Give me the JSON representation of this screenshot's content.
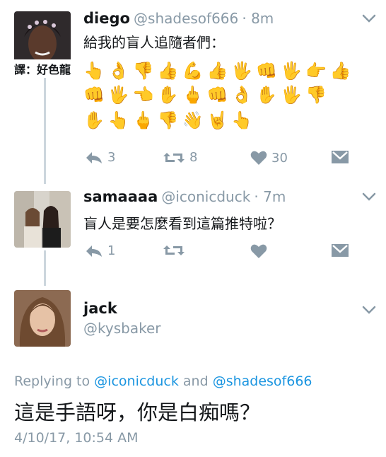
{
  "tweets": [
    {
      "name": "diego",
      "handle": "@shadesof666",
      "time": "· 8m",
      "text": "給我的盲人追隨者們：",
      "translation_label": "譯：好色龍",
      "emoji_rows": [
        [
          "👆",
          "👌",
          "👎",
          "👍",
          "💪",
          "👍",
          "🖐",
          "👊",
          "🖐",
          "👉",
          "👍"
        ],
        [
          "👊",
          "🖐",
          "👈",
          "✋",
          "🖕",
          "👊",
          "👌",
          "✋",
          "🖐",
          "👎"
        ],
        [
          "✋",
          "👆",
          "🖕",
          "👎",
          "👋",
          "🤘",
          "👆"
        ]
      ],
      "reply_count": "3",
      "retweet_count": "8",
      "like_count": "30"
    },
    {
      "name": "samaaaa",
      "handle": "@iconicduck",
      "time": "· 7m",
      "text": "盲人是要怎麼看到這篇推特啦？",
      "reply_count": "1"
    },
    {
      "name": "jack",
      "handle": "@kysbaker"
    }
  ],
  "main_tweet": {
    "replying_prefix": "Replying to",
    "mention_1": "@iconicduck",
    "replying_and": "and",
    "mention_2": "@shadesof666",
    "text": "這是手語呀，你是白痴嗎？",
    "timestamp": "4/10/17, 10:54 AM"
  },
  "colors": {
    "name": "#14171a",
    "muted": "#8899a6",
    "link": "#1b95e0",
    "thread_line": "#ccd6dd"
  },
  "icons": [
    "reply-icon",
    "retweet-icon",
    "like-icon",
    "direct-message-icon",
    "chevron-down-icon"
  ]
}
